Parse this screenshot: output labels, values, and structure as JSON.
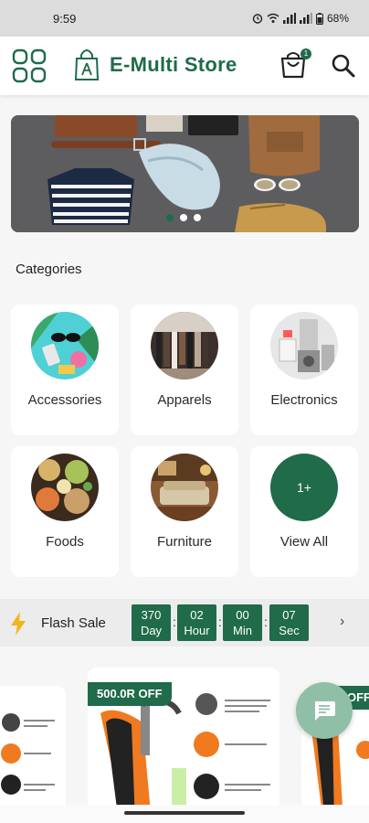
{
  "status_bar": {
    "time": "9:59",
    "battery": "68%"
  },
  "header": {
    "title": "E-Multi Store",
    "cart_count": "1"
  },
  "colors": {
    "primary": "#1f6b4a",
    "fab": "#8fc0a7",
    "banner_bg": "#5d5d5f"
  },
  "icons": [
    "grid-menu-icon",
    "shopping-bag-logo-icon",
    "cart-icon",
    "search-icon",
    "lightning-icon",
    "chevron-right-icon",
    "chat-icon"
  ],
  "banner": {
    "slide_count": 3,
    "active_slide": 1
  },
  "categories": {
    "title": "Categories",
    "items": [
      {
        "label": "Accessories"
      },
      {
        "label": "Apparels"
      },
      {
        "label": "Electronics"
      },
      {
        "label": "Foods"
      },
      {
        "label": "Furniture"
      },
      {
        "label": "View All",
        "badge": "1+"
      }
    ]
  },
  "flash_sale": {
    "title": "Flash Sale",
    "timer": [
      {
        "value": "370",
        "unit": "Day"
      },
      {
        "value": "02",
        "unit": "Hour"
      },
      {
        "value": "00",
        "unit": "Min"
      },
      {
        "value": "07",
        "unit": "Sec"
      }
    ]
  },
  "products": [
    {
      "offer": "500.0R OFF"
    },
    {
      "offer": "OFF"
    }
  ]
}
